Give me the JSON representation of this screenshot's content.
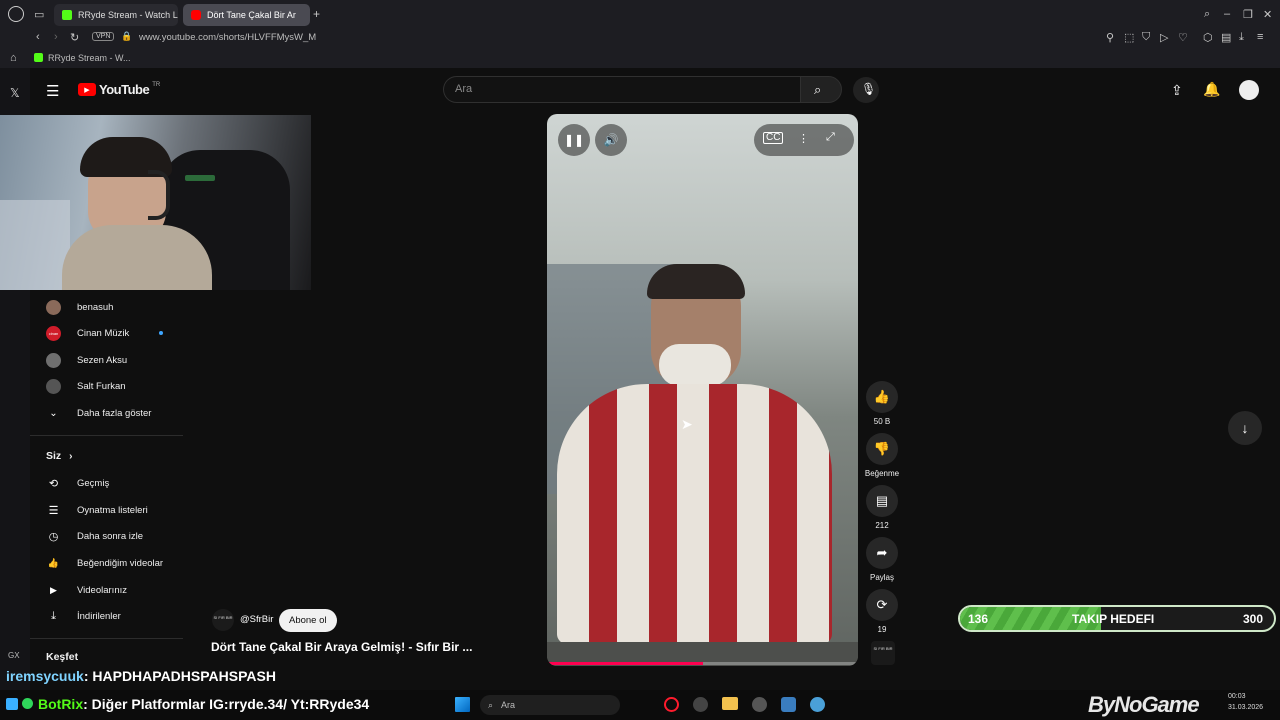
{
  "browser": {
    "tabs": [
      {
        "title": "RRyde Stream - Watch Liv",
        "fav_color": "#53fc18"
      },
      {
        "title": "Dört Tane Çakal Bir Ar",
        "fav_color": "#ff0000"
      }
    ],
    "url": "www.youtube.com/shorts/HLVFFMysW_M",
    "vpn_label": "VPN",
    "bookmark": "RRyde Stream - W...",
    "new_tab": "+"
  },
  "youtube": {
    "logo_text": "YouTube",
    "region": "TR",
    "search_placeholder": "Ara"
  },
  "sidebar": {
    "subscriptions": [
      {
        "name": "benasuh",
        "avatar_color": "#8a6a5a"
      },
      {
        "name": "Cinan Müzik",
        "avatar_color": "#d01c2a",
        "avatar_text": "cinan",
        "new": true
      },
      {
        "name": "Sezen Aksu",
        "avatar_color": "#6f6f6f"
      },
      {
        "name": "Salt Furkan",
        "avatar_color": "#555"
      }
    ],
    "show_more": "Daha fazla göster",
    "you_header": "Siz",
    "you_items": [
      {
        "label": "Geçmiş",
        "icon": "history-icon",
        "glyph": "⟲"
      },
      {
        "label": "Oynatma listeleri",
        "icon": "playlist-icon",
        "glyph": "☰"
      },
      {
        "label": "Daha sonra izle",
        "icon": "watch-later-icon",
        "glyph": "◷"
      },
      {
        "label": "Beğendiğim videolar",
        "icon": "like-icon",
        "glyph": "👍"
      },
      {
        "label": "Videolarınız",
        "icon": "your-videos-icon",
        "glyph": "▶"
      },
      {
        "label": "İndirilenler",
        "icon": "download-icon",
        "glyph": "⤓"
      }
    ],
    "explore_header": "Keşfet"
  },
  "short": {
    "channel": "@SfrBir",
    "channel_avatar_text": "SI FIR BIR",
    "subscribe": "Abone ol",
    "title": "Dört Tane Çakal Bir Araya Gelmiş! - Sıfır Bir ...",
    "progress": 0.5,
    "actions": [
      {
        "name": "like",
        "icon": "thumbs-up-icon",
        "glyph": "👍",
        "label": "50 B"
      },
      {
        "name": "dislike",
        "icon": "thumbs-down-icon",
        "glyph": "👎",
        "label": "Beğenme"
      },
      {
        "name": "comments",
        "icon": "comment-icon",
        "glyph": "▤",
        "label": "212"
      },
      {
        "name": "share",
        "icon": "share-icon",
        "glyph": "➦",
        "label": "Paylaş"
      },
      {
        "name": "remix",
        "icon": "remix-icon",
        "glyph": "⟳",
        "label": "19"
      }
    ]
  },
  "overlay": {
    "chat1_user": "iremsycuuk",
    "chat1_msg": ": HAPDHAPADHSPAHSPASH",
    "chat2_user": "BotRix",
    "chat2_msg": ": Diğer Platformlar IG:rryde.34/ Yt:RRyde34",
    "goal_current": "136",
    "goal_label": "TAKIP HEDEFI",
    "goal_target": "300",
    "goal_fill": 0.45,
    "brand": "ByNoGame"
  },
  "taskbar": {
    "search": "Ara",
    "time": "00:03",
    "date": "31.03.2026"
  },
  "rail_labels": {
    "gx": "GX"
  }
}
